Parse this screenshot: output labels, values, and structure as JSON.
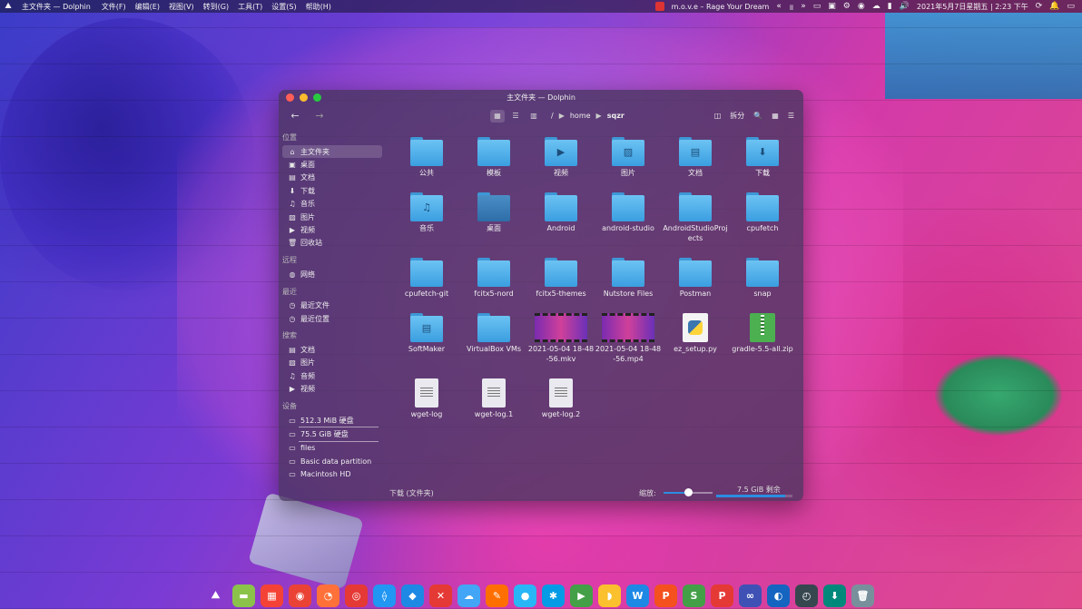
{
  "topbar": {
    "app_title": "主文件夹 — Dolphin",
    "menus": [
      "文件(F)",
      "编辑(E)",
      "视图(V)",
      "转到(G)",
      "工具(T)",
      "设置(S)",
      "帮助(H)"
    ],
    "media": "m.o.v.e – Rage Your Dream",
    "datetime": "2021年5月7日星期五 | 2:23 下午"
  },
  "window": {
    "title": "主文件夹 — Dolphin",
    "breadcrumb": [
      "/",
      "home",
      "sqzr"
    ],
    "split_label": "拆分"
  },
  "sidebar": {
    "sections": [
      {
        "title": "位置",
        "items": [
          {
            "label": "主文件夹",
            "icon": "home-icon",
            "glyph": "⌂",
            "active": true
          },
          {
            "label": "桌面",
            "icon": "desktop-icon",
            "glyph": "▣"
          },
          {
            "label": "文档",
            "icon": "document-icon",
            "glyph": "▤"
          },
          {
            "label": "下载",
            "icon": "download-icon",
            "glyph": "⬇"
          },
          {
            "label": "音乐",
            "icon": "music-icon",
            "glyph": "♫"
          },
          {
            "label": "图片",
            "icon": "picture-icon",
            "glyph": "▨"
          },
          {
            "label": "视频",
            "icon": "video-icon",
            "glyph": "▶"
          },
          {
            "label": "回收站",
            "icon": "trash-icon",
            "glyph": "🗑"
          }
        ]
      },
      {
        "title": "远程",
        "items": [
          {
            "label": "网络",
            "icon": "network-icon",
            "glyph": "◍"
          }
        ]
      },
      {
        "title": "最近",
        "items": [
          {
            "label": "最近文件",
            "icon": "recent-files-icon",
            "glyph": "◷"
          },
          {
            "label": "最近位置",
            "icon": "recent-locations-icon",
            "glyph": "◷"
          }
        ]
      },
      {
        "title": "搜索",
        "items": [
          {
            "label": "文档",
            "icon": "document-icon",
            "glyph": "▤"
          },
          {
            "label": "图片",
            "icon": "picture-icon",
            "glyph": "▨"
          },
          {
            "label": "音频",
            "icon": "music-icon",
            "glyph": "♫"
          },
          {
            "label": "视频",
            "icon": "video-icon",
            "glyph": "▶"
          }
        ]
      },
      {
        "title": "设备",
        "items": [
          {
            "label": "512.3 MiB 硬盘",
            "icon": "drive-icon",
            "glyph": "▭",
            "bar": true
          },
          {
            "label": "75.5 GiB 硬盘",
            "icon": "drive-icon",
            "glyph": "▭",
            "bar": true
          },
          {
            "label": "files",
            "icon": "drive-icon",
            "glyph": "▭"
          },
          {
            "label": "Basic data partition",
            "icon": "drive-icon",
            "glyph": "▭"
          },
          {
            "label": "Macintosh HD",
            "icon": "drive-icon",
            "glyph": "▭"
          }
        ]
      }
    ]
  },
  "files": [
    {
      "label": "公共",
      "kind": "folder",
      "emblem": ""
    },
    {
      "label": "模板",
      "kind": "folder",
      "emblem": ""
    },
    {
      "label": "视频",
      "kind": "folder",
      "emblem": "▶"
    },
    {
      "label": "图片",
      "kind": "folder-image",
      "emblem": ""
    },
    {
      "label": "文档",
      "kind": "folder",
      "emblem": "▤"
    },
    {
      "label": "下载",
      "kind": "folder",
      "emblem": "⬇",
      "selected": true
    },
    {
      "label": "音乐",
      "kind": "folder",
      "emblem": "♫"
    },
    {
      "label": "桌面",
      "kind": "folder-dark",
      "emblem": ""
    },
    {
      "label": "Android",
      "kind": "folder",
      "emblem": ""
    },
    {
      "label": "android-studio",
      "kind": "folder",
      "emblem": ""
    },
    {
      "label": "AndroidStudioProjects",
      "kind": "folder",
      "emblem": ""
    },
    {
      "label": "cpufetch",
      "kind": "folder",
      "emblem": ""
    },
    {
      "label": "cpufetch-git",
      "kind": "folder",
      "emblem": ""
    },
    {
      "label": "fcitx5-nord",
      "kind": "folder",
      "emblem": ""
    },
    {
      "label": "fcitx5-themes",
      "kind": "folder",
      "emblem": ""
    },
    {
      "label": "Nutstore Files",
      "kind": "folder",
      "emblem": ""
    },
    {
      "label": "Postman",
      "kind": "folder",
      "emblem": ""
    },
    {
      "label": "snap",
      "kind": "folder",
      "emblem": ""
    },
    {
      "label": "SoftMaker",
      "kind": "folder",
      "emblem": "▤"
    },
    {
      "label": "VirtualBox VMs",
      "kind": "folder",
      "emblem": ""
    },
    {
      "label": "2021-05-04 18-48-56.mkv",
      "kind": "video",
      "emblem": ""
    },
    {
      "label": "2021-05-04 18-48-56.mp4",
      "kind": "video",
      "emblem": ""
    },
    {
      "label": "ez_setup.py",
      "kind": "python",
      "emblem": ""
    },
    {
      "label": "gradle-5.5-all.zip",
      "kind": "zip",
      "emblem": ""
    },
    {
      "label": "wget-log",
      "kind": "doc",
      "emblem": ""
    },
    {
      "label": "wget-log.1",
      "kind": "doc",
      "emblem": ""
    },
    {
      "label": "wget-log.2",
      "kind": "doc",
      "emblem": ""
    }
  ],
  "statusbar": {
    "selection": "下载 (文件夹)",
    "zoom_label": "缩放:",
    "zoom_level": 0.5,
    "free_space": "7.5 GiB 剩余",
    "free_fraction": 0.9
  },
  "dock": [
    {
      "name": "launcher-icon",
      "glyph": "⛰",
      "color": "transparent"
    },
    {
      "name": "files-icon",
      "glyph": "▬",
      "color": "#8bc34a"
    },
    {
      "name": "windows-icon",
      "glyph": "▦",
      "color": "#f44336"
    },
    {
      "name": "chrome-icon",
      "glyph": "◉",
      "color": "#ea4335"
    },
    {
      "name": "firefox-icon",
      "glyph": "◔",
      "color": "#ff7139"
    },
    {
      "name": "netease-music-icon",
      "glyph": "◎",
      "color": "#e53935"
    },
    {
      "name": "flow-icon",
      "glyph": "⟠",
      "color": "#2196f3"
    },
    {
      "name": "vscode-icon",
      "glyph": "◆",
      "color": "#1e88e5"
    },
    {
      "name": "xmind-icon",
      "glyph": "✕",
      "color": "#e53935"
    },
    {
      "name": "cloud-icon",
      "glyph": "☁",
      "color": "#42a5f5"
    },
    {
      "name": "pen-icon",
      "glyph": "✎",
      "color": "#ff6f00"
    },
    {
      "name": "qq-icon",
      "glyph": "●",
      "color": "#29b6f6"
    },
    {
      "name": "star-icon",
      "glyph": "✱",
      "color": "#039be5"
    },
    {
      "name": "play-icon",
      "glyph": "▶",
      "color": "#43a047"
    },
    {
      "name": "note-icon",
      "glyph": "◗",
      "color": "#fbc02d"
    },
    {
      "name": "wps-writer-icon",
      "glyph": "W",
      "color": "#1e88e5"
    },
    {
      "name": "wps-presentation-icon",
      "glyph": "P",
      "color": "#f4511e"
    },
    {
      "name": "wps-spreadsheet-icon",
      "glyph": "S",
      "color": "#43a047"
    },
    {
      "name": "wps-pdf-icon",
      "glyph": "P",
      "color": "#e53935"
    },
    {
      "name": "baidu-netdisk-icon",
      "glyph": "∞",
      "color": "#3f51b5"
    },
    {
      "name": "browser-icon",
      "glyph": "◐",
      "color": "#1565c0"
    },
    {
      "name": "system-icon",
      "glyph": "◴",
      "color": "#37474f"
    },
    {
      "name": "transfer-icon",
      "glyph": "⬇",
      "color": "#00897b"
    },
    {
      "name": "trash-icon",
      "glyph": "🗑",
      "color": "#78909c"
    }
  ]
}
